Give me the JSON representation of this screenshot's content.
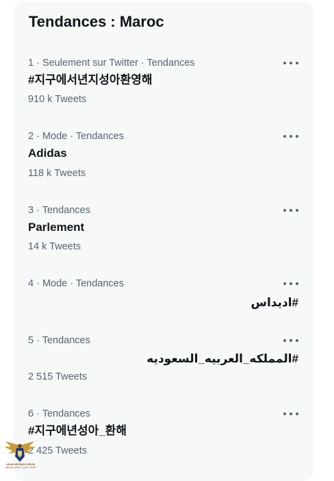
{
  "panel": {
    "title": "Tendances : Maroc"
  },
  "trends": [
    {
      "meta": "1 · Seulement sur Twitter · Tendances",
      "name": "#지구에서년지성아환영해",
      "count": "910 k Tweets",
      "dir": "ltr"
    },
    {
      "meta": "2 · Mode · Tendances",
      "name": "Adidas",
      "count": "118 k Tweets",
      "dir": "ltr"
    },
    {
      "meta": "3 · Tendances",
      "name": "Parlement",
      "count": "14 k Tweets",
      "dir": "ltr"
    },
    {
      "meta": "4 · Mode · Tendances",
      "name": "#اديداس",
      "count": "",
      "dir": "rtl"
    },
    {
      "meta": "5 · Tendances",
      "name": "#المملكه_العربيه_السعوديه",
      "count": "2 515 Tweets",
      "dir": "rtl"
    },
    {
      "meta": "6 · Tendances",
      "name": "#지구에년성아_환해",
      "count": "2 425 Tweets",
      "dir": "ltr"
    }
  ],
  "watermark": {
    "line1": "ARAB DEFENSE FORUM",
    "line2": "المنتدى العربي للدفاع والتسليح"
  },
  "icons": {
    "more": "more-horizontal-icon",
    "logo": "eagle-emblem-icon"
  }
}
